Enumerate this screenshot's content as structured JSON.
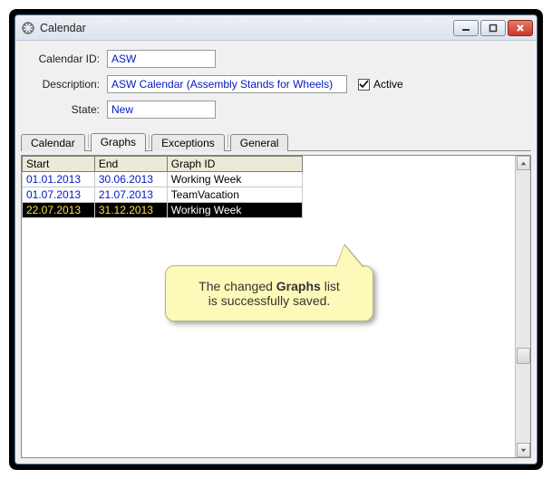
{
  "window": {
    "title": "Calendar"
  },
  "form": {
    "calendar_id_label": "Calendar ID:",
    "calendar_id_value": "ASW",
    "description_label": "Description:",
    "description_value": "ASW Calendar (Assembly Stands for Wheels)",
    "active_label": "Active",
    "active_checked": true,
    "state_label": "State:",
    "state_value": "New"
  },
  "tabs": {
    "items": [
      "Calendar",
      "Graphs",
      "Exceptions",
      "General"
    ],
    "active_index": 1
  },
  "grid": {
    "columns": [
      "Start",
      "End",
      "Graph ID"
    ],
    "rows": [
      {
        "start": "01.01.2013",
        "end": "30.06.2013",
        "graph_id": "Working Week",
        "selected": false
      },
      {
        "start": "01.07.2013",
        "end": "21.07.2013",
        "graph_id": "TeamVacation",
        "selected": false
      },
      {
        "start": "22.07.2013",
        "end": "31.12.2013",
        "graph_id": "Working Week",
        "selected": true
      }
    ]
  },
  "callout": {
    "line1_prefix": "The changed ",
    "line1_bold": "Graphs",
    "line1_suffix": " list",
    "line2": "is successfully saved."
  }
}
